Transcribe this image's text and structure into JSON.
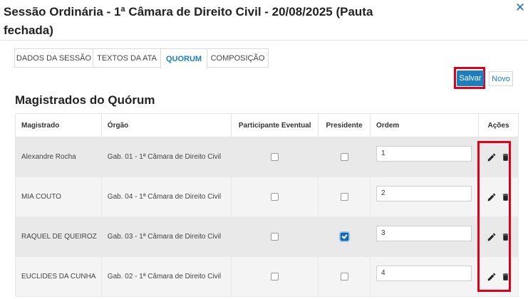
{
  "dialog": {
    "title": "Sessão Ordinária - 1ª Câmara de Direito Civil - 20/08/2025 (Pauta fechada)",
    "close_icon": "close-icon"
  },
  "tabs": [
    {
      "label": "DADOS DA SESSÃO",
      "active": false
    },
    {
      "label": "TEXTOS DA ATA",
      "active": false
    },
    {
      "label": "QUORUM",
      "active": true
    },
    {
      "label": "COMPOSIÇÃO",
      "active": false
    }
  ],
  "buttons": {
    "save_label": "Salvar",
    "new_label": "Novo"
  },
  "section_title": "Magistrados do Quórum",
  "table": {
    "headers": [
      "Magistrado",
      "Órgão",
      "Participante Eventual",
      "Presidente",
      "Ordem",
      "Ações"
    ],
    "rows": [
      {
        "magistrado": "Alexandre Rocha",
        "orgao": "Gab. 01 - 1ª Câmara de Direito Civil",
        "eventual": false,
        "presidente": false,
        "ordem": "1"
      },
      {
        "magistrado": "MIA COUTO",
        "orgao": "Gab. 04 - 1ª Câmara de Direito Civil",
        "eventual": false,
        "presidente": false,
        "ordem": "2"
      },
      {
        "magistrado": "RAQUEL DE QUEIROZ",
        "orgao": "Gab. 03 - 1ª Câmara de Direito Civil",
        "eventual": false,
        "presidente": true,
        "ordem": "3"
      },
      {
        "magistrado": "EUCLIDES DA CUNHA",
        "orgao": "Gab. 02 - 1ª Câmara de Direito Civil",
        "eventual": false,
        "presidente": false,
        "ordem": "4"
      }
    ],
    "action_icons": [
      "edit-icon",
      "trash-icon"
    ]
  },
  "colors": {
    "accent": "#1c7ebd",
    "highlight": "#e0001a"
  }
}
